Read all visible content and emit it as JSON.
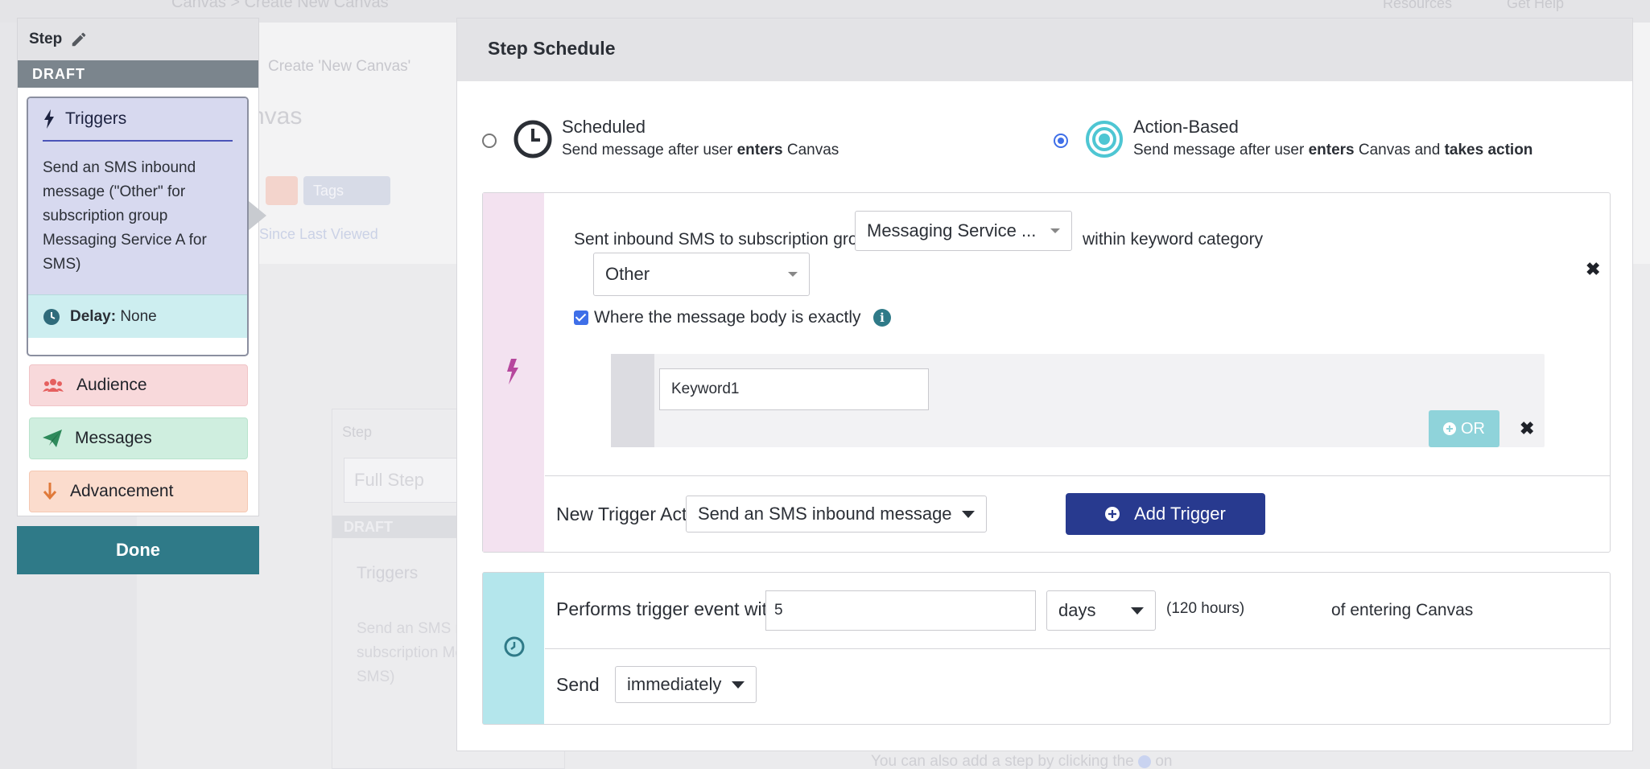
{
  "background": {
    "breadcrumb": "Canvas > Create New Canvas",
    "resources": "Resources",
    "get_help": "Get Help",
    "tab_label": "Create 'New Canvas'",
    "canvas_name": "nvas",
    "tags_label": "Tags",
    "since_last_viewed": "Since Last Viewed",
    "ghost_step": {
      "title": "Step",
      "name_input": "Full Step",
      "draft": "DRAFT",
      "triggers": "Triggers",
      "desc": "Send an SMS message (\"Ot subscription Messaging Se SMS)"
    },
    "bottom_hint": "You can also add a step by clicking the",
    "bottom_hint_end": "on"
  },
  "step_panel": {
    "title": "Step",
    "draft_label": "DRAFT",
    "triggers_label": "Triggers",
    "triggers_description": "Send an SMS inbound message (\"Other\" for subscription group Messaging Service A for SMS)",
    "delay_label": "Delay:",
    "delay_value": "None",
    "audience_label": "Audience",
    "messages_label": "Messages",
    "advancement_label": "Advancement",
    "done_label": "Done"
  },
  "schedule": {
    "title": "Step Schedule",
    "scheduled": {
      "title": "Scheduled",
      "sub_pre": "Send message after user ",
      "sub_bold": "enters",
      "sub_post": " Canvas",
      "selected": false
    },
    "action_based": {
      "title": "Action-Based",
      "sub_pre": "Send message after user ",
      "sub_bold1": "enters",
      "sub_mid": " Canvas and ",
      "sub_bold2": "takes action",
      "selected": true
    },
    "trigger": {
      "sent_label": "Sent inbound SMS to subscription group",
      "subscription_group": "Messaging Service ...",
      "within_label": "within keyword category",
      "keyword_category": "Other",
      "body_exact_label": "Where the message body is exactly",
      "body_exact_checked": true,
      "keyword_value": "Keyword1",
      "or_label": "OR",
      "new_action_label": "New Trigger Action",
      "new_action_value": "Send an SMS inbound message",
      "add_trigger_label": "Add Trigger"
    },
    "timing": {
      "performs_label": "Performs trigger event within",
      "window_value": "5",
      "unit": "days",
      "hours_note": "(120 hours)",
      "of_entering": "of entering Canvas",
      "send_label": "Send",
      "send_value": "immediately"
    }
  },
  "colors": {
    "teal_button": "#2f7a88",
    "add_trigger_navy": "#283a8f",
    "or_button": "#8fd3da",
    "triggers_bg": "#d7d9ef",
    "delay_bg": "#cdeef0",
    "audience_bg": "#f8d9db",
    "messages_bg": "#cfeedf",
    "advancement_bg": "#fbdccd",
    "trigger_strip": "#f3e2f0",
    "timing_strip": "#b4e6ec"
  }
}
